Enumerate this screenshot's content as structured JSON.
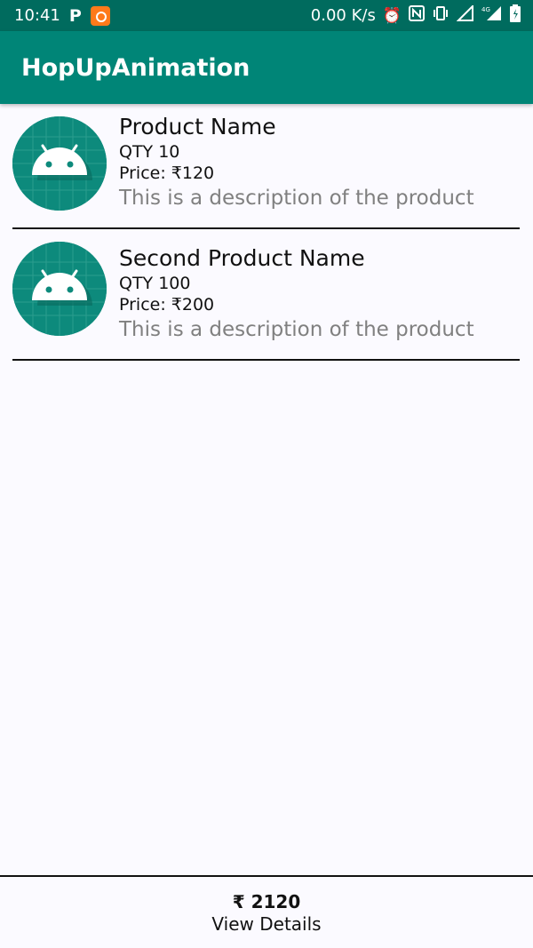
{
  "status_bar": {
    "time": "10:41",
    "network_speed": "0.00 K/s",
    "icons": [
      "p-icon",
      "notification-app-icon",
      "alarm-icon",
      "nfc-icon",
      "vibrate-icon",
      "signal-icon",
      "4g-signal-icon",
      "battery-icon"
    ]
  },
  "app_bar": {
    "title": "HopUpAnimation",
    "color": "#008577"
  },
  "products": [
    {
      "name": "Product Name",
      "qty": "QTY 10",
      "price": "Price: ₹120",
      "description": "This is a description of the product"
    },
    {
      "name": "Second Product Name",
      "qty": "QTY 100",
      "price": "Price: ₹200",
      "description": "This is a description of the product"
    }
  ],
  "footer": {
    "total": "₹ 2120",
    "view_details_label": "View Details"
  }
}
